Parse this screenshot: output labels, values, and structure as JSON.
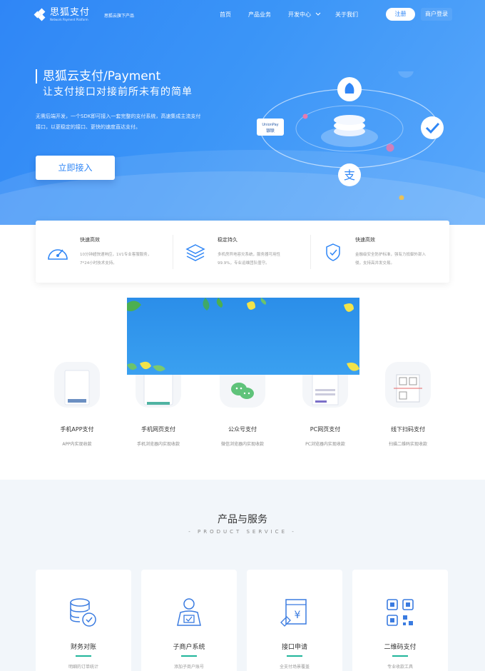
{
  "header": {
    "brand": "思狐支付",
    "brand_sub": "Network Payment Platform",
    "slogan": "思狐云旗下产品",
    "nav": [
      "首页",
      "产品业务",
      "开发中心",
      "关于我们"
    ],
    "register": "注册",
    "login": "商户登录"
  },
  "hero": {
    "title": "思狐云支付/Payment",
    "subtitle": "让支付接口对接前所未有的简单",
    "desc_line1": "无需后端开发，一个SDK即可接入一套完整的支付系统，高速集成主流支付",
    "desc_line2": "接口，以更稳定的接口、更快的速度直达支付。",
    "cta": "立即接入",
    "unionpay_text": "UnionPay 银联"
  },
  "features": [
    {
      "title": "快速高效",
      "desc": "10分钟超快速响应，1V1专业客服服务，7*24小时技术支持。",
      "icon": "speedometer-icon"
    },
    {
      "title": "稳定持久",
      "desc": "多机房异地容灾系统，服务器可用性99.9%，专业运维团队值守。",
      "icon": "layers-icon"
    },
    {
      "title": "快速高效",
      "desc": "金融级安全防护标准，强有力抵御外部入侵，支持高并发交易。",
      "icon": "shield-icon"
    }
  ],
  "methods": [
    {
      "name": "手机APP支付",
      "sub": "APP内实现收款"
    },
    {
      "name": "手机网页支付",
      "sub": "手机浏览器内实现收款"
    },
    {
      "name": "公众号支付",
      "sub": "微信浏览器内实现收款"
    },
    {
      "name": "PC网页支付",
      "sub": "PC浏览器内实现收款"
    },
    {
      "name": "线下扫码支付",
      "sub": "扫描二维码实现收款"
    }
  ],
  "service": {
    "title": "产品与服务",
    "subtitle": "- PRODUCT SERVICE -",
    "cards": [
      {
        "name": "财务对账",
        "sub": "明细的订单统计",
        "icon": "database-check-icon"
      },
      {
        "name": "子商户系统",
        "sub": "添加子商户账号",
        "icon": "user-check-icon"
      },
      {
        "name": "接口申请",
        "sub": "全支付场景覆盖",
        "icon": "document-yen-icon"
      },
      {
        "name": "二维码支付",
        "sub": "专业收款工具",
        "icon": "qrcode-icon"
      }
    ]
  },
  "colors": {
    "brand_blue": "#2f86f6",
    "accent_green": "#1fb59a"
  }
}
